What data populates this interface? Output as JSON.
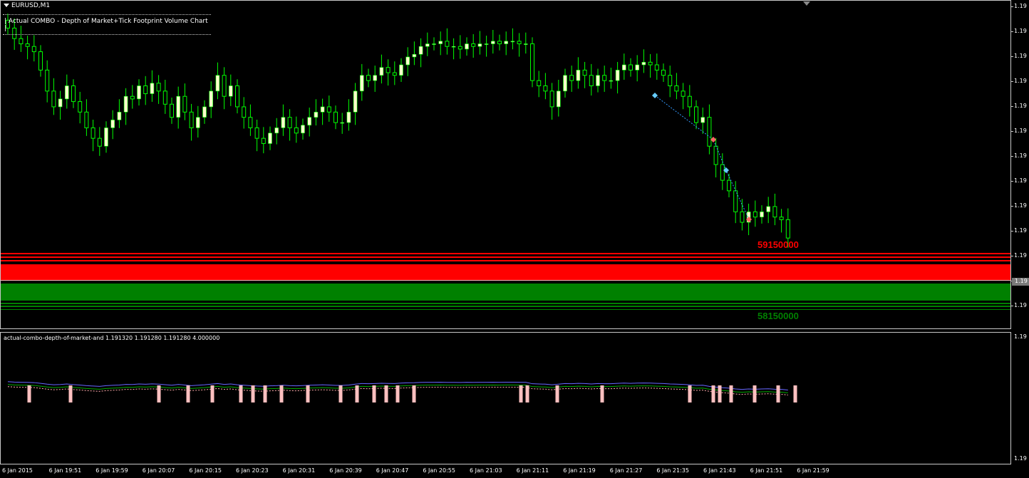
{
  "window": {
    "symbol_label": "EURUSD,M1",
    "indicator_label": "| Actual COMBO - Depth of Market+Tick Footprint Volume Chart |",
    "subwindow_label": "actual-combo-depth-of-market-and 1.191320 1.191280 1.191280 4.000000"
  },
  "price_axis": {
    "labels": [
      "1.19",
      "1.19",
      "1.19",
      "1.19",
      "1.19",
      "1.19",
      "1.19",
      "1.19",
      "1.19",
      "1.19",
      "1.19",
      "1.19",
      "1.19"
    ],
    "current_price_tag": "1.19"
  },
  "sub_axis": {
    "labels": [
      "1.19",
      "1.19"
    ]
  },
  "time_axis": {
    "labels": [
      "6 Jan 2015",
      "6 Jan 19:51",
      "6 Jan 19:59",
      "6 Jan 20:07",
      "6 Jan 20:15",
      "6 Jan 20:23",
      "6 Jan 20:31",
      "6 Jan 20:39",
      "6 Jan 20:47",
      "6 Jan 20:55",
      "6 Jan 21:03",
      "6 Jan 21:11",
      "6 Jan 21:19",
      "6 Jan 21:27",
      "6 Jan 21:35",
      "6 Jan 21:43",
      "6 Jan 21:51",
      "6 Jan 21:59"
    ]
  },
  "depth_of_market": {
    "ask_volume": "59150000",
    "bid_volume": "58150000",
    "ask_color": "#ff0000",
    "bid_color": "#008000"
  },
  "colors": {
    "background": "#000000",
    "candle_bull": "#ffffcc",
    "candle_wick": "#00ff00",
    "axis_text": "#ffffff"
  },
  "chart_data": {
    "type": "candlestick",
    "closes": [
      1.1921,
      1.19206,
      1.19204,
      1.19203,
      1.19201,
      1.19194,
      1.19186,
      1.1918,
      1.19183,
      1.19188,
      1.19182,
      1.19178,
      1.19172,
      1.19168,
      1.19165,
      1.19172,
      1.19175,
      1.19178,
      1.19184,
      1.19183,
      1.19188,
      1.19185,
      1.19189,
      1.19186,
      1.19181,
      1.19176,
      1.19184,
      1.19178,
      1.19172,
      1.19176,
      1.1918,
      1.19186,
      1.19192,
      1.19184,
      1.19188,
      1.1918,
      1.19176,
      1.19172,
      1.19168,
      1.19166,
      1.1917,
      1.19172,
      1.19176,
      1.19172,
      1.1917,
      1.19173,
      1.19176,
      1.19178,
      1.1918,
      1.19178,
      1.19174,
      1.19174,
      1.19178,
      1.19186,
      1.19192,
      1.1919,
      1.19192,
      1.19195,
      1.19193,
      1.19192,
      1.19196,
      1.19199,
      1.192,
      1.19203,
      1.19204,
      1.19204,
      1.19205,
      1.19203,
      1.19203,
      1.19202,
      1.19204,
      1.19203,
      1.19204,
      1.19204,
      1.19205,
      1.19204,
      1.19205,
      1.19205,
      1.19204,
      1.19204,
      1.1919,
      1.19188,
      1.19186,
      1.1918,
      1.19186,
      1.19192,
      1.1919,
      1.19194,
      1.19192,
      1.19188,
      1.19192,
      1.1919,
      1.1919,
      1.19194,
      1.19196,
      1.19194,
      1.19196,
      1.19197,
      1.19196,
      1.19194,
      1.19192,
      1.19188,
      1.19186,
      1.19184,
      1.1918,
      1.19174,
      1.19176,
      1.19165,
      1.19158,
      1.19152,
      1.19148,
      1.1914,
      1.19136,
      1.1914,
      1.19138,
      1.1914,
      1.19142,
      1.19138,
      1.19137,
      1.1913
    ]
  }
}
